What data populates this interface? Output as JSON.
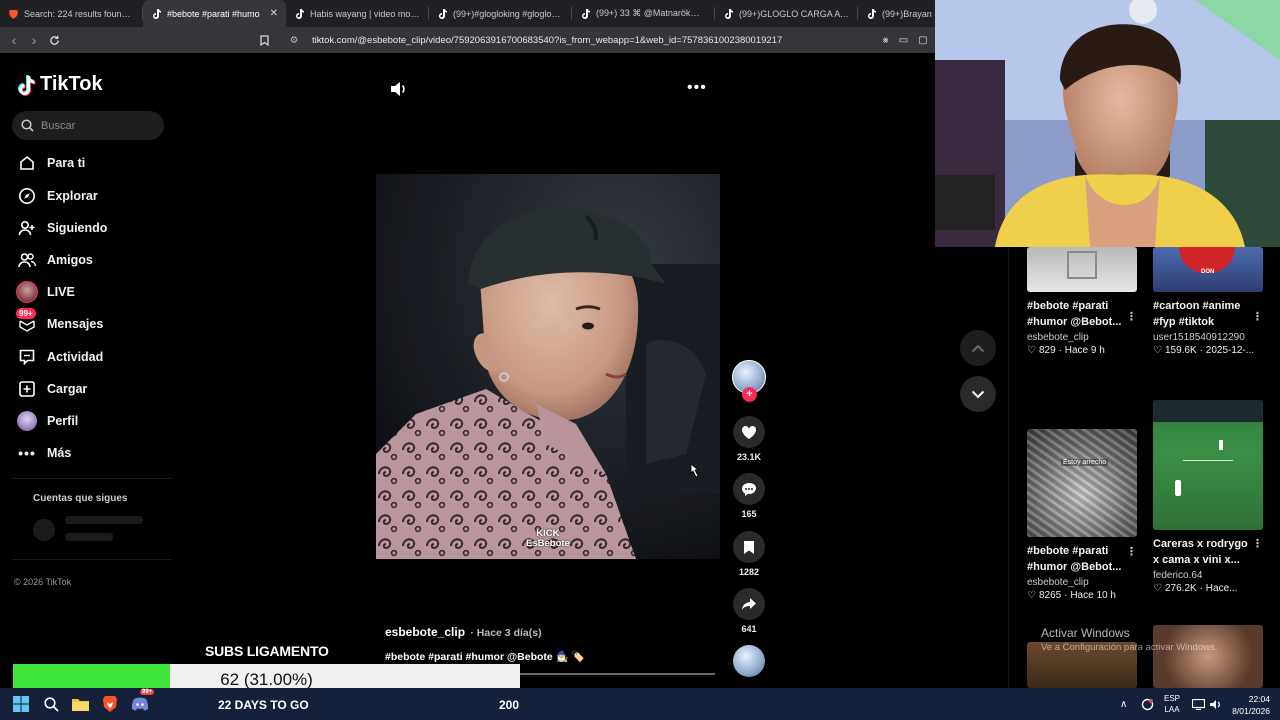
{
  "browser": {
    "tabs": [
      {
        "title": "Search: 224 results found for \"j",
        "icon": "brave-favicon-icon"
      },
      {
        "title": "#bebote #parati #humo",
        "icon": "tiktok-favicon-icon",
        "active": true
      },
      {
        "title": "Habis wayang | video modifika",
        "icon": "tiktok-favicon-icon"
      },
      {
        "title": "(99+)#glogloking #glogloplay",
        "icon": "tiktok-favicon-icon"
      },
      {
        "title": "(99+) 33 ⌘ @Matnarök🐲 #fy",
        "icon": "tiktok-favicon-icon"
      },
      {
        "title": "(99+)GLOGLO CARGA A EMIY",
        "icon": "tiktok-favicon-icon"
      },
      {
        "title": "(99+)Brayan So",
        "icon": "tiktok-favicon-icon"
      }
    ],
    "url": "tiktok.com/@esbebote_clip/video/7592063916700683540?is_from_webapp=1&web_id=7578361002380019217"
  },
  "sidebar": {
    "brand": "TikTok",
    "search_placeholder": "Buscar",
    "items": [
      {
        "label": "Para ti",
        "icon": "home-icon"
      },
      {
        "label": "Explorar",
        "icon": "compass-icon"
      },
      {
        "label": "Siguiendo",
        "icon": "following-icon"
      },
      {
        "label": "Amigos",
        "icon": "friends-icon"
      },
      {
        "label": "LIVE",
        "icon": "live-icon"
      },
      {
        "label": "Mensajes",
        "icon": "messages-icon",
        "badge": "99+"
      },
      {
        "label": "Actividad",
        "icon": "activity-icon"
      },
      {
        "label": "Cargar",
        "icon": "upload-icon"
      },
      {
        "label": "Perfil",
        "icon": "profile-icon"
      },
      {
        "label": "Más",
        "icon": "more-icon"
      }
    ],
    "following_heading": "Cuentas que sigues",
    "copyright": "© 2026 TikTok"
  },
  "video": {
    "watermark_line1": "KICK",
    "watermark_line2": "EsBebote",
    "author": "esbebote_clip",
    "ago": "· Hace 3 día(s)",
    "description": "#bebote #parati #humor @Bebote 🧙‍♂️ 🏷️",
    "likes": "23.1K",
    "comments": "165",
    "saves": "1282",
    "shares": "641"
  },
  "recommendations": [
    {
      "title": "#bebote #parati #humor @Bebot...",
      "user": "esbebote_clip",
      "likes": "829",
      "when": "· Hace 9 h"
    },
    {
      "title": "#cartoon #anime #fyp #tiktok",
      "user": "user1518540912290",
      "likes": "159.6K",
      "when": "· 2025-12-..."
    },
    {
      "title": "#bebote #parati #humor @Bebot...",
      "user": "esbebote_clip",
      "likes": "8265",
      "when": "· Hace 10 h",
      "thumb_caption": "Estoy arrecho"
    },
    {
      "title": "Careras x rodrygo x cama x vini x...",
      "user": "federico.64",
      "likes": "276.2K",
      "when": "· Hace..."
    }
  ],
  "overlay": {
    "subs_title": "SUBS LIGAMENTO",
    "subs_progress_text": "62 (31.00%)",
    "subs_progress_fraction": 0.31,
    "subs_days": "22 DAYS TO GO",
    "subs_goal": "200",
    "windows_activate": "Activar Windows",
    "windows_activate_sub": "Ve a Configuración para activar Windows."
  },
  "taskbar": {
    "lang_top": "ESP",
    "lang_bottom": "LAA",
    "time": "22:04",
    "date": "8/01/2026",
    "discord_badge": "99+"
  },
  "colors": {
    "tiktok_red": "#fe2c55",
    "progress_green": "#3fe53b",
    "taskbar": "#15213a"
  }
}
